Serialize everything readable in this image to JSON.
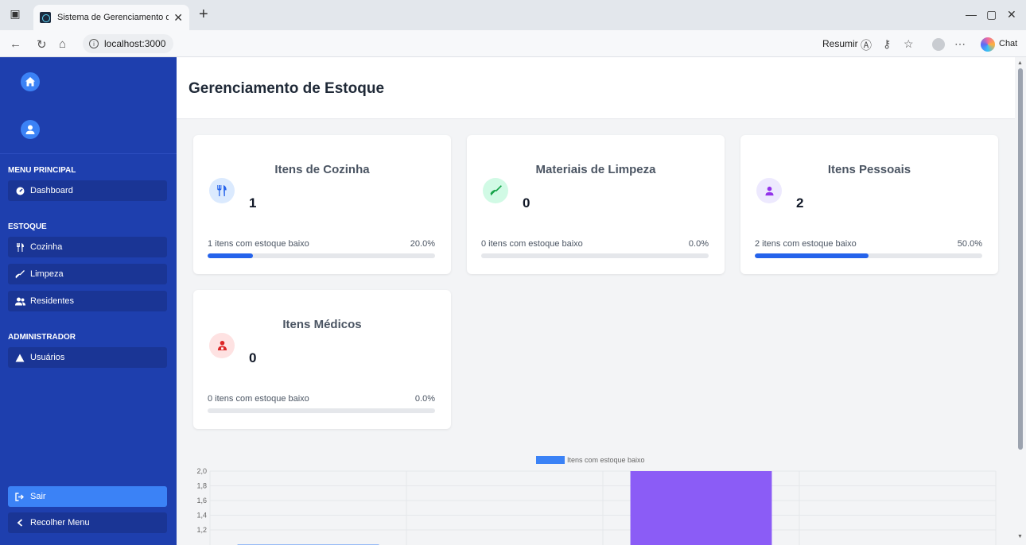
{
  "browser": {
    "tab_title": "Sistema de Gerenciamento de Est",
    "url": "localhost:3000",
    "resumir": "Resumir",
    "chat": "Chat"
  },
  "sidebar": {
    "sections": [
      {
        "label": "MENU PRINCIPAL"
      },
      {
        "label": "ESTOQUE"
      },
      {
        "label": "ADMINISTRADOR"
      }
    ],
    "items": [
      {
        "label": "Dashboard",
        "icon": "gauge-icon"
      },
      {
        "label": "Cozinha",
        "icon": "utensils-icon"
      },
      {
        "label": "Limpeza",
        "icon": "broom-icon"
      },
      {
        "label": "Residentes",
        "icon": "users-icon"
      },
      {
        "label": "Usuários",
        "icon": "warning-icon"
      }
    ],
    "sair": "Sair",
    "recolher": "Recolher Menu"
  },
  "header": {
    "title": "Gerenciamento de Estoque"
  },
  "cards": [
    {
      "title": "Itens de Cozinha",
      "count": "1",
      "note": "1 itens com estoque baixo",
      "pct": "20.0%",
      "fill": 0.2,
      "icon": "utensils-icon",
      "icon_bg": "#dbeafe",
      "icon_color": "#2563eb"
    },
    {
      "title": "Materiais de Limpeza",
      "count": "0",
      "note": "0 itens com estoque baixo",
      "pct": "0.0%",
      "fill": 0.0,
      "icon": "broom-icon",
      "icon_bg": "#d1fae5",
      "icon_color": "#16a34a"
    },
    {
      "title": "Itens Pessoais",
      "count": "2",
      "note": "2 itens com estoque baixo",
      "pct": "50.0%",
      "fill": 0.5,
      "icon": "user-icon",
      "icon_bg": "#ede9fe",
      "icon_color": "#9333ea"
    },
    {
      "title": "Itens Médicos",
      "count": "0",
      "note": "0 itens com estoque baixo",
      "pct": "0.0%",
      "fill": 0.0,
      "icon": "user-doctor-icon",
      "icon_bg": "#fee2e2",
      "icon_color": "#dc2626"
    }
  ],
  "chart_data": {
    "type": "bar",
    "legend": "Itens com estoque baixo",
    "legend_position": "top",
    "legend_color": "#3b82f6",
    "categories": [
      "",
      "",
      "",
      ""
    ],
    "values": [
      1,
      0,
      2,
      0
    ],
    "bar_colors": [
      "#3b82f6",
      "#10b981",
      "#8b5cf6",
      "#ef4444"
    ],
    "yticks": [
      "2,0",
      "1,8",
      "1,6",
      "1,4",
      "1,2"
    ],
    "ylim": [
      0,
      2
    ],
    "grid": true
  }
}
